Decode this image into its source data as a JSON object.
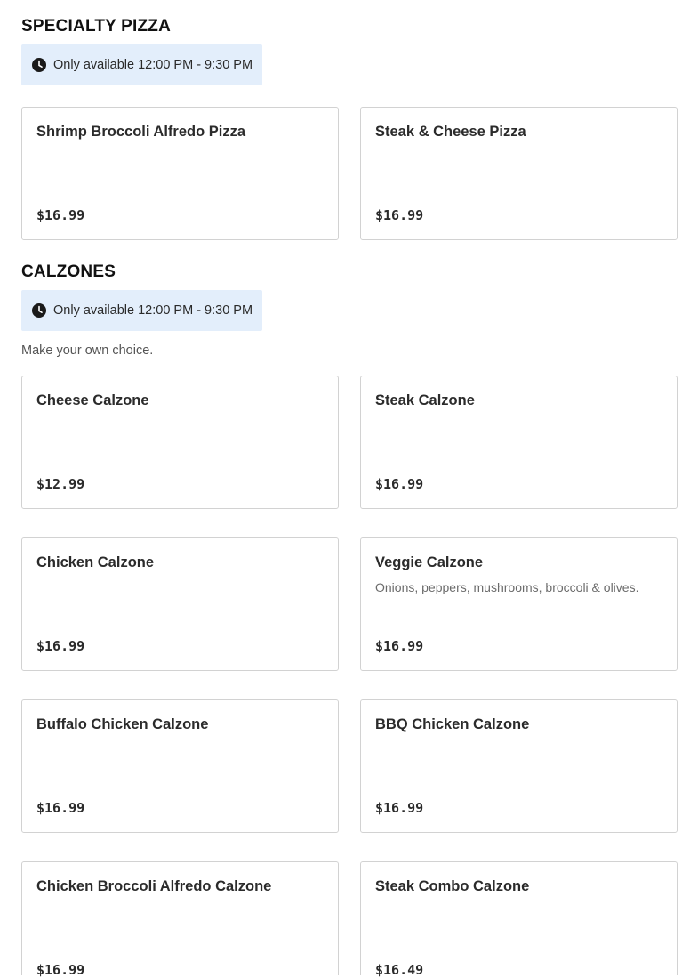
{
  "sections": {
    "specialty": {
      "title": "SPECIALTY PIZZA",
      "availability": "Only available 12:00 PM - 9:30 PM",
      "items": [
        {
          "name": "Shrimp Broccoli Alfredo Pizza",
          "price": "$16.99"
        },
        {
          "name": "Steak & Cheese Pizza",
          "price": "$16.99"
        }
      ]
    },
    "calzones": {
      "title": "CALZONES",
      "availability": "Only available 12:00 PM - 9:30 PM",
      "description": "Make your own choice.",
      "items": [
        {
          "name": "Cheese Calzone",
          "price": "$12.99"
        },
        {
          "name": "Steak Calzone",
          "price": "$16.99"
        },
        {
          "name": "Chicken Calzone",
          "price": "$16.99"
        },
        {
          "name": "Veggie Calzone",
          "description": "Onions, peppers, mushrooms, broccoli & olives.",
          "price": "$16.99"
        },
        {
          "name": "Buffalo Chicken Calzone",
          "price": "$16.99"
        },
        {
          "name": "BBQ Chicken Calzone",
          "price": "$16.99"
        },
        {
          "name": "Chicken Broccoli Alfredo Calzone",
          "price": "$16.99"
        },
        {
          "name": "Steak Combo Calzone",
          "price": "$16.49"
        }
      ]
    }
  },
  "icons": {
    "availability": "clock-icon"
  },
  "colors": {
    "availability_bg": "#e3eefb",
    "card_border": "#d2d2d2"
  }
}
